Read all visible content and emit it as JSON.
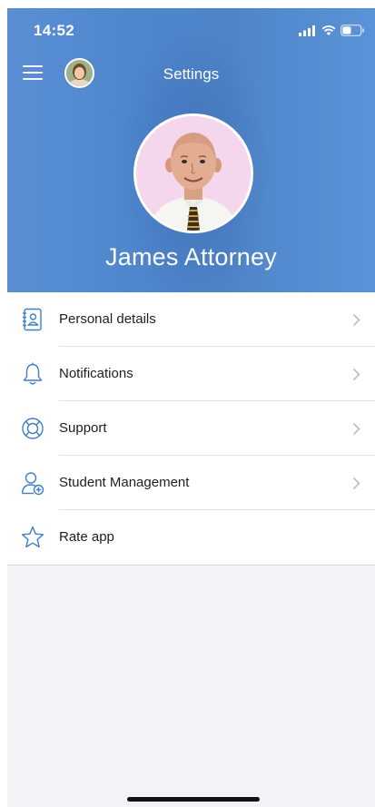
{
  "status_bar": {
    "time": "14:52"
  },
  "header": {
    "title": "Settings"
  },
  "profile": {
    "name": "James Attorney"
  },
  "menu": {
    "items": [
      {
        "label": "Personal details",
        "icon": "contact-book-icon"
      },
      {
        "label": "Notifications",
        "icon": "bell-icon"
      },
      {
        "label": "Support",
        "icon": "lifebuoy-icon"
      },
      {
        "label": "Student Management",
        "icon": "add-user-icon"
      },
      {
        "label": "Rate app",
        "icon": "star-icon"
      }
    ]
  },
  "colors": {
    "header_blue": "#5a8fd3",
    "icon_blue": "#3f7fc7",
    "chevron": "#b9bcc3",
    "background": "#f2f3f7"
  }
}
